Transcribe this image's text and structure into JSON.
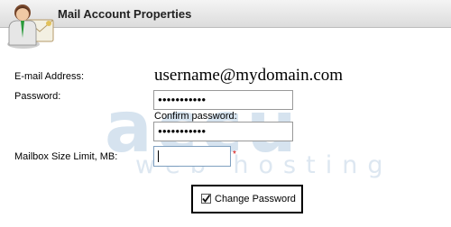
{
  "header": {
    "title": "Mail Account Properties"
  },
  "form": {
    "email_label": "E-mail Address:",
    "email_value": "username@mydomain.com",
    "password_label": "Password:",
    "password_value": "●●●●●●●●●●●",
    "confirm_label": "Confirm password:",
    "confirm_value": "●●●●●●●●●●●",
    "mailbox_label": "Mailbox Size Limit, MB:",
    "mailbox_value": "",
    "required_mark": "*",
    "change_password_label": "Change Password",
    "change_password_checked": true
  },
  "watermark": {
    "brand": "accu",
    "sub": "web hosting"
  },
  "colors": {
    "header_bg": "#dcdcdc",
    "required": "#d40000",
    "watermark": "#c8d8e8"
  }
}
